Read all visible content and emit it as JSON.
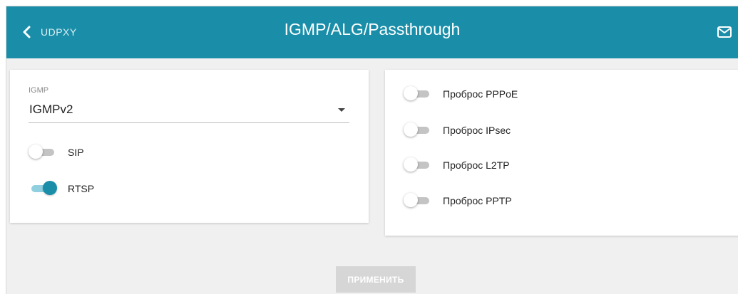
{
  "header": {
    "back_label": "UDPXY",
    "title": "IGMP/ALG/Passthrough",
    "icons": {
      "back": "chevron-left-icon",
      "notifications": "mail-icon"
    },
    "color": "#1a8ea9"
  },
  "igmp": {
    "label": "IGMP",
    "selected": "IGMPv2"
  },
  "alg": [
    {
      "label": "SIP",
      "enabled": false
    },
    {
      "label": "RTSP",
      "enabled": true
    }
  ],
  "passthrough": [
    {
      "label": "Проброс PPPoE",
      "enabled": false
    },
    {
      "label": "Проброс IPsec",
      "enabled": false
    },
    {
      "label": "Проброс L2TP",
      "enabled": false
    },
    {
      "label": "Проброс PPTP",
      "enabled": false
    }
  ],
  "apply_button": {
    "label": "ПРИМЕНИТЬ",
    "enabled": false
  },
  "colors": {
    "accent": "#1a8ea9",
    "toggle_on_track": "#8fcfe0",
    "toggle_off_track": "#c4c4c4",
    "background": "#f0f0f0"
  }
}
